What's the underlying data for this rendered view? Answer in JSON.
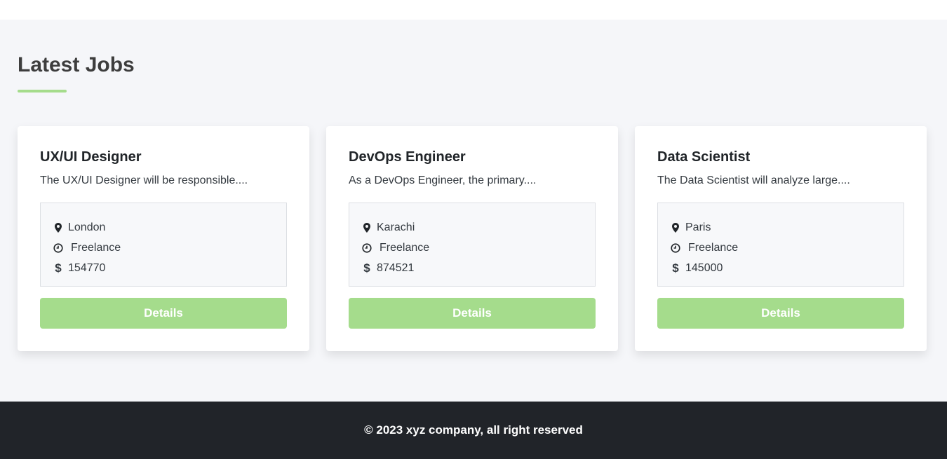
{
  "section": {
    "title": "Latest Jobs",
    "accent_color": "#a5dc8c"
  },
  "jobs": [
    {
      "title": "UX/UI Designer",
      "description": "The UX/UI Designer will be responsible....",
      "location": "London",
      "type": "Freelance",
      "salary": "154770",
      "button_label": "Details"
    },
    {
      "title": "DevOps Engineer",
      "description": "As a DevOps Engineer, the primary....",
      "location": "Karachi",
      "type": "Freelance",
      "salary": "874521",
      "button_label": "Details"
    },
    {
      "title": "Data Scientist",
      "description": "The Data Scientist will analyze large....",
      "location": "Paris",
      "type": "Freelance",
      "salary": "145000",
      "button_label": "Details"
    }
  ],
  "icons": {
    "location": "map-marker-icon",
    "type": "clock-icon",
    "salary": "dollar-icon"
  },
  "footer": {
    "text": "© 2023 xyz company, all right reserved"
  }
}
